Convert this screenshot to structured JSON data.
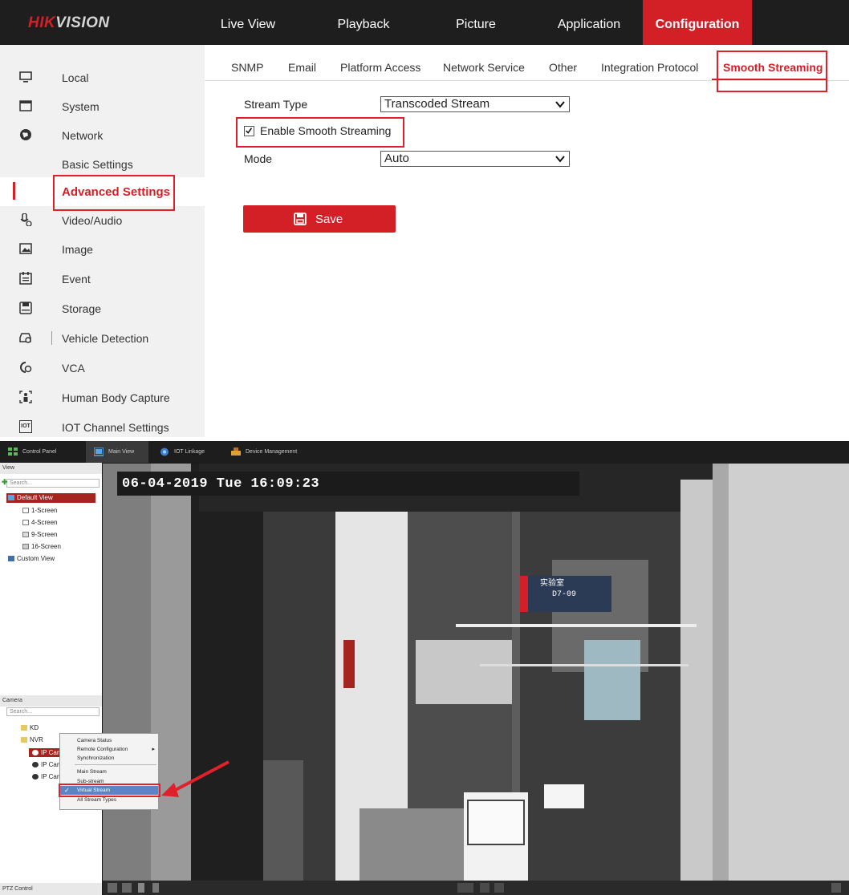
{
  "brand": {
    "logo_hik": "HIK",
    "logo_vision": "VISION"
  },
  "nav": [
    "Live View",
    "Playback",
    "Picture",
    "Application",
    "Configuration"
  ],
  "nav_active": "Configuration",
  "sidebar": {
    "items": [
      {
        "label": "Local",
        "icon": "monitor-icon"
      },
      {
        "label": "System",
        "icon": "window-icon"
      },
      {
        "label": "Network",
        "icon": "globe-icon"
      },
      {
        "label": "Video/Audio",
        "icon": "microphone-icon"
      },
      {
        "label": "Image",
        "icon": "image-icon"
      },
      {
        "label": "Event",
        "icon": "calendar-icon"
      },
      {
        "label": "Storage",
        "icon": "disk-icon"
      },
      {
        "label": "Vehicle Detection",
        "icon": "vehicle-search-icon"
      },
      {
        "label": "VCA",
        "icon": "vca-icon"
      },
      {
        "label": "Human Body Capture",
        "icon": "human-capture-icon"
      },
      {
        "label": "IOT Channel Settings",
        "icon": "iot-icon"
      }
    ],
    "sub_items": [
      "Basic Settings",
      "Advanced Settings"
    ],
    "iot_icon_text": "IOT"
  },
  "tabs": [
    "SNMP",
    "Email",
    "Platform Access",
    "Network Service",
    "Other",
    "Integration Protocol",
    "Smooth Streaming"
  ],
  "form": {
    "stream_type_label": "Stream Type",
    "stream_type_value": "Transcoded Stream",
    "enable_label": "Enable Smooth Streaming",
    "enable_checked": true,
    "mode_label": "Mode",
    "mode_value": "Auto",
    "save_label": "Save"
  },
  "client": {
    "tabs": [
      "Control Panel",
      "Main View",
      "IOT Linkage",
      "Device Management"
    ],
    "view_header": "View",
    "search_placeholder": "Search...",
    "view_tree": [
      "Default View",
      "1-Screen",
      "4-Screen",
      "9-Screen",
      "16-Screen",
      "Custom View"
    ],
    "camera_header": "Camera",
    "camera_tree": [
      "KD",
      "NVR",
      "IP Camera",
      "IP Came",
      "IP Came"
    ],
    "context_menu": [
      "Camera Status",
      "Remote Configuration",
      "Synchronization",
      "Main Stream",
      "Sub-stream",
      "Virtual Stream",
      "All Stream Types"
    ],
    "context_selected": "Virtual Stream",
    "osd_timestamp": "06-04-2019 Tue 16:09:23",
    "room_sign": {
      "title": "实验室",
      "room": "D7-09"
    },
    "ptz_label": "PTZ Control"
  },
  "colors": {
    "brand_red": "#d32027",
    "topbar": "#1e1e1e",
    "highlight_box": "#e0202a",
    "menu_select": "#5d84c6"
  }
}
